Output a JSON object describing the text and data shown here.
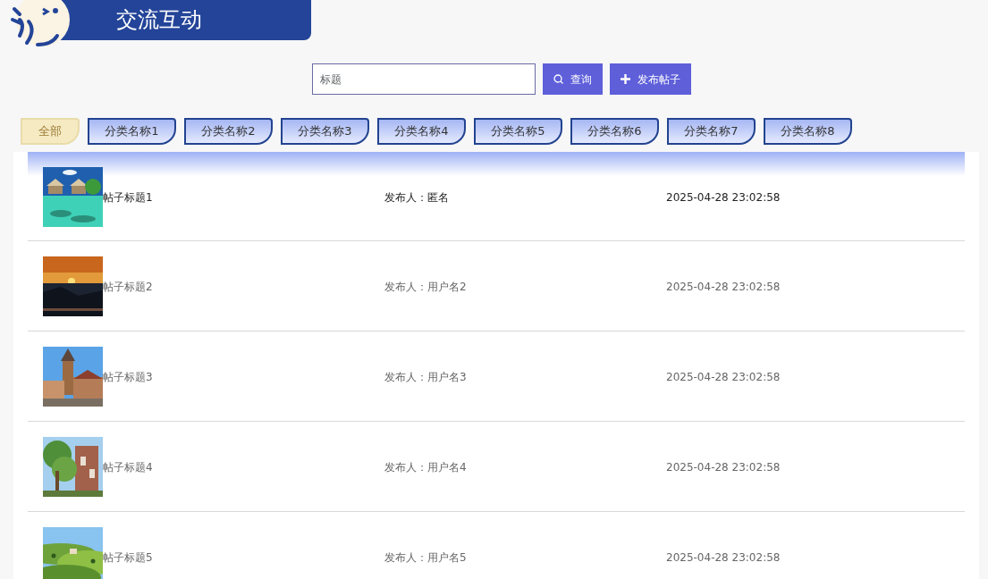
{
  "header": {
    "title": "交流互动"
  },
  "search": {
    "placeholder": "标题",
    "search_button": "查询",
    "post_button": "发布帖子"
  },
  "categories": [
    {
      "label": "全部",
      "selected": true
    },
    {
      "label": "分类名称1",
      "selected": false
    },
    {
      "label": "分类名称2",
      "selected": false
    },
    {
      "label": "分类名称3",
      "selected": false
    },
    {
      "label": "分类名称4",
      "selected": false
    },
    {
      "label": "分类名称5",
      "selected": false
    },
    {
      "label": "分类名称6",
      "selected": false
    },
    {
      "label": "分类名称7",
      "selected": false
    },
    {
      "label": "分类名称8",
      "selected": false
    }
  ],
  "posts": [
    {
      "title": "帖子标题1",
      "author": "发布人：匿名",
      "time": "2025-04-28 23:02:58",
      "highlighted": true,
      "kind": "picture"
    },
    {
      "title": "帖子标题2",
      "author": "发布人：用户名2",
      "time": "2025-04-28 23:02:58",
      "highlighted": false,
      "kind": "picture"
    },
    {
      "title": "帖子标题3",
      "author": "发布人：用户名3",
      "time": "2025-04-28 23:02:58",
      "highlighted": false,
      "kind": "picture"
    },
    {
      "title": "帖子标题4",
      "author": "发布人：用户名4",
      "time": "2025-04-28 23:02:58",
      "highlighted": false,
      "kind": "picture"
    },
    {
      "title": "帖子标题5",
      "author": "发布人：用户名5",
      "time": "2025-04-28 23:02:58",
      "highlighted": false,
      "kind": "picture"
    }
  ]
}
